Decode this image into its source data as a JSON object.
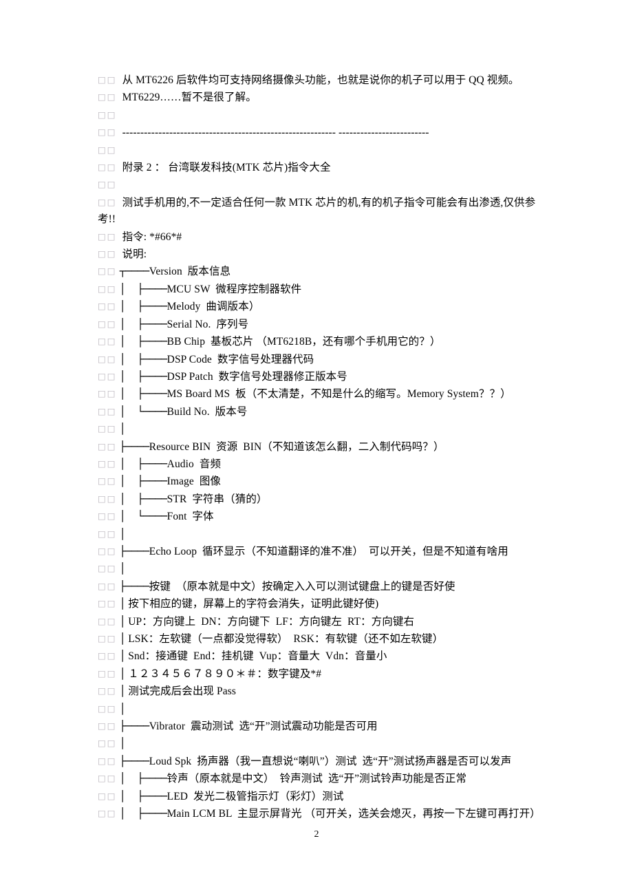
{
  "document": {
    "page_number": "2",
    "tofu_marker": "□□",
    "lines": [
      {
        "id": "l1",
        "tofu": true,
        "tree": "",
        "text": " 从 MT6226 后软件均可支持网络摄像头功能，也就是说你的机子可以用于 QQ 视频。"
      },
      {
        "id": "l2",
        "tofu": true,
        "tree": "",
        "text": " MT6229……暂不是很了解。"
      },
      {
        "id": "l3",
        "tofu": true,
        "tree": "",
        "text": ""
      },
      {
        "id": "l4",
        "tofu": true,
        "tree": "",
        "text": " ----------------------------------------------------------- -------------------------"
      },
      {
        "id": "l5",
        "tofu": true,
        "tree": "",
        "text": ""
      },
      {
        "id": "l6",
        "tofu": true,
        "tree": "",
        "text": " 附录 2 ： 台湾联发科技(MTK 芯片)指令大全"
      },
      {
        "id": "l7",
        "tofu": true,
        "tree": "",
        "text": ""
      },
      {
        "id": "l8",
        "tofu": true,
        "tree": "",
        "text": " 测试手机用的,不一定适合任何一款 MTK 芯片的机,有的机子指令可能会有出渗透,仅供参考!!"
      },
      {
        "id": "l9",
        "tofu": true,
        "tree": "",
        "text": " 指令: *#66*#"
      },
      {
        "id": "l10",
        "tofu": true,
        "tree": "",
        "text": " 说明:"
      },
      {
        "id": "l11",
        "tofu": true,
        "tree": "┬────",
        "text": "Version  版本信息"
      },
      {
        "id": "l12",
        "tofu": true,
        "tree": "│  ├────",
        "text": "MCU SW  微程序控制器软件"
      },
      {
        "id": "l13",
        "tofu": true,
        "tree": "│  ├────",
        "text": "Melody  曲调版本）"
      },
      {
        "id": "l14",
        "tofu": true,
        "tree": "│  ├────",
        "text": "Serial No.  序列号"
      },
      {
        "id": "l15",
        "tofu": true,
        "tree": "│  ├────",
        "text": "BB Chip  基板芯片 （MT6218B，还有哪个手机用它的？）"
      },
      {
        "id": "l16",
        "tofu": true,
        "tree": "│  ├────",
        "text": "DSP Code  数字信号处理器代码"
      },
      {
        "id": "l17",
        "tofu": true,
        "tree": "│  ├────",
        "text": "DSP Patch  数字信号处理器修正版本号"
      },
      {
        "id": "l18",
        "tofu": true,
        "tree": "│  ├────",
        "text": "MS Board MS  板（不太清楚，不知是什么的缩写。Memory System？？）"
      },
      {
        "id": "l19",
        "tofu": true,
        "tree": "│  └────",
        "text": "Build No.  版本号"
      },
      {
        "id": "l20",
        "tofu": true,
        "tree": "│",
        "text": ""
      },
      {
        "id": "l21",
        "tofu": true,
        "tree": "├────",
        "text": "Resource BIN  资源  BIN（不知道该怎么翻，二入制代码吗？）"
      },
      {
        "id": "l22",
        "tofu": true,
        "tree": "│  ├────",
        "text": "Audio  音频"
      },
      {
        "id": "l23",
        "tofu": true,
        "tree": "│  ├────",
        "text": "Image  图像"
      },
      {
        "id": "l24",
        "tofu": true,
        "tree": "│  ├────",
        "text": "STR  字符串（猜的）"
      },
      {
        "id": "l25",
        "tofu": true,
        "tree": "│  └────",
        "text": "Font  字体"
      },
      {
        "id": "l26",
        "tofu": true,
        "tree": "│",
        "text": ""
      },
      {
        "id": "l27",
        "tofu": true,
        "tree": "├────",
        "text": "Echo Loop  循环显示（不知道翻译的准不准）  可以开关，但是不知道有啥用"
      },
      {
        "id": "l28",
        "tofu": true,
        "tree": "│",
        "text": ""
      },
      {
        "id": "l29",
        "tofu": true,
        "tree": "├────",
        "text": "按键  （原本就是中文）按确定入入可以测试键盘上的键是否好使"
      },
      {
        "id": "l30",
        "tofu": true,
        "tree": "│",
        "text": " 按下相应的键，屏幕上的字符会消失，证明此键好使)"
      },
      {
        "id": "l31",
        "tofu": true,
        "tree": "│",
        "text": " UP：方向键上  DN：方向键下  LF：方向键左  RT：方向键右"
      },
      {
        "id": "l32",
        "tofu": true,
        "tree": "│",
        "text": " LSK：左软键（一点都没觉得软）  RSK：有软键（还不如左软键）"
      },
      {
        "id": "l33",
        "tofu": true,
        "tree": "│",
        "text": " Snd：接通键  End：挂机键  Vup：音量大  Vdn：音量小"
      },
      {
        "id": "l34",
        "tofu": true,
        "tree": "│",
        "text": " １２３４５６７８９０＊＃：数字键及*#"
      },
      {
        "id": "l35",
        "tofu": true,
        "tree": "│",
        "text": " 测试完成后会出现 Pass"
      },
      {
        "id": "l36",
        "tofu": true,
        "tree": "│",
        "text": ""
      },
      {
        "id": "l37",
        "tofu": true,
        "tree": "├────",
        "text": "Vibrator  震动测试  选“开”测试震动功能是否可用"
      },
      {
        "id": "l38",
        "tofu": true,
        "tree": "│",
        "text": ""
      },
      {
        "id": "l39",
        "tofu": true,
        "tree": "├────",
        "text": "Loud Spk  扬声器（我一直想说“喇叭”）测试  选“开”测试扬声器是否可以发声"
      },
      {
        "id": "l40",
        "tofu": true,
        "tree": "│  ├────",
        "text": "铃声（原本就是中文）  铃声测试  选“开”测试铃声功能是否正常"
      },
      {
        "id": "l41",
        "tofu": true,
        "tree": "│  ├────",
        "text": "LED  发光二极管指示灯（彩灯）测试"
      },
      {
        "id": "l42",
        "tofu": true,
        "tree": "│  ├────",
        "text": "Main LCM BL  主显示屏背光 （可开关，选关会熄灭，再按一下左键可再打开）"
      }
    ]
  }
}
